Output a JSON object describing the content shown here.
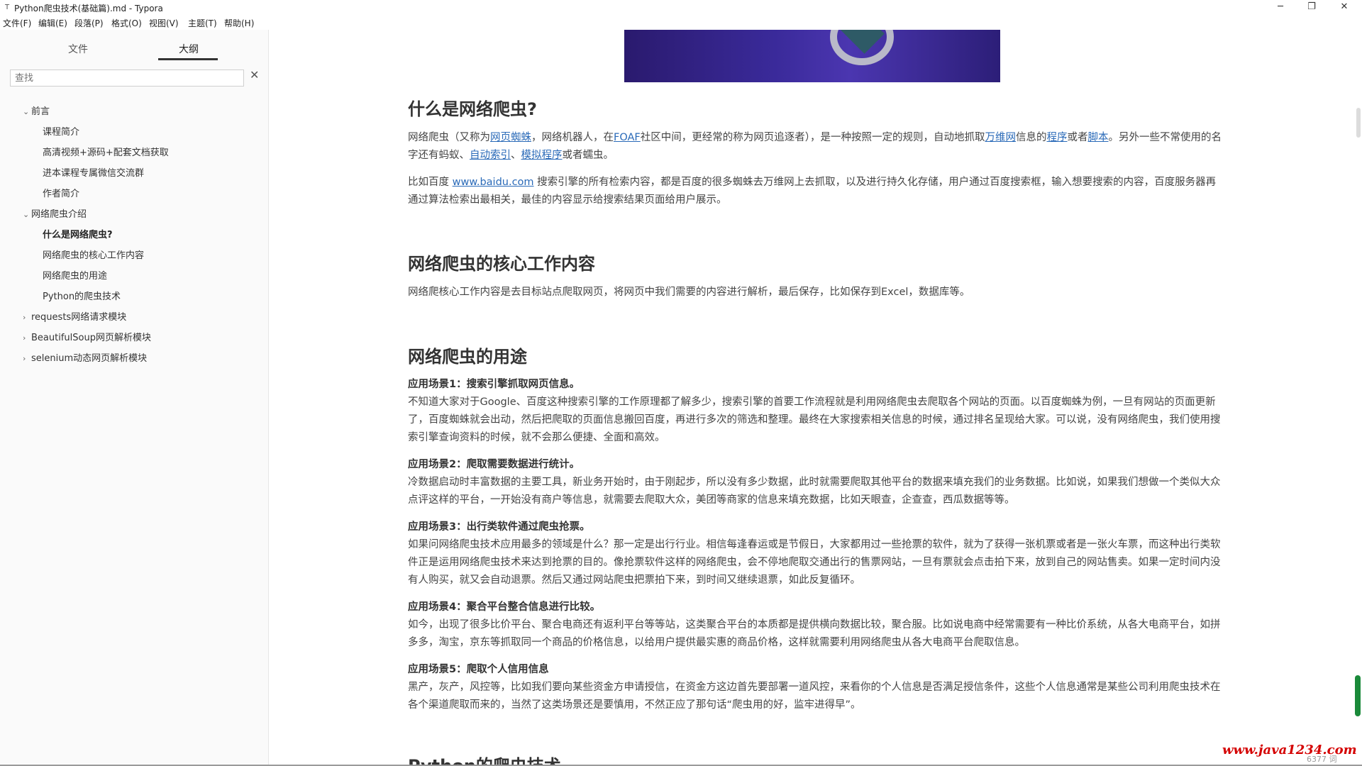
{
  "window": {
    "app_icon": "T",
    "title": "Python爬虫技术(基础篇).md - Typora",
    "min_glyph": "─",
    "max_glyph": "❐",
    "close_glyph": "✕"
  },
  "menu": [
    "文件(F)",
    "编辑(E)",
    "段落(P)",
    "格式(O)",
    "视图(V)",
    "主题(T)",
    "帮助(H)"
  ],
  "sidebar": {
    "tab_files": "文件",
    "tab_outline": "大纲",
    "search_placeholder": "查找",
    "search_clear": "✕",
    "items": [
      {
        "label": "前言",
        "chev": "⌄"
      },
      {
        "label": "课程简介"
      },
      {
        "label": "高清视频+源码+配套文档获取"
      },
      {
        "label": "进本课程专属微信交流群"
      },
      {
        "label": "作者简介"
      },
      {
        "label": "网络爬虫介绍",
        "chev": "⌄"
      },
      {
        "label": "什么是网络爬虫?"
      },
      {
        "label": "网络爬虫的核心工作内容"
      },
      {
        "label": "网络爬虫的用途"
      },
      {
        "label": "Python的爬虫技术"
      },
      {
        "label": "requests网络请求模块",
        "chev": "›"
      },
      {
        "label": "BeautifulSoup网页解析模块",
        "chev": "›"
      },
      {
        "label": "selenium动态网页解析模块",
        "chev": "›"
      }
    ],
    "footer_left": "‹",
    "footer_code": "</>"
  },
  "content": {
    "h_what": "什么是网络爬虫?",
    "p1": {
      "t1": "网络爬虫（又称为",
      "l1": "网页蜘蛛",
      "t2": "，网络机器人，在",
      "l2": "FOAF",
      "t3": "社区中间，更经常的称为网页追逐者），是一种按照一定的规则，自动地抓取",
      "l3": "万维网",
      "t4": "信息的",
      "l4": "程序",
      "t5": "或者",
      "l5": "脚本",
      "t6": "。另外一些不常使用的名字还有蚂蚁、",
      "l6": "自动索引",
      "t7": "、",
      "l7": "模拟程序",
      "t8": "或者蠕虫。"
    },
    "p2": {
      "t1": "比如百度 ",
      "l1": "www.baidu.com",
      "t2": " 搜索引擎的所有检索内容，都是百度的很多蜘蛛去万维网上去抓取，以及进行持久化存储，用户通过百度搜索框，输入想要搜索的内容，百度服务器再通过算法检索出最相关，最佳的内容显示给搜索结果页面给用户展示。"
    },
    "h_core": "网络爬虫的核心工作内容",
    "p_core": "网络爬核心工作内容是去目标站点爬取网页，将网页中我们需要的内容进行解析，最后保存，比如保存到Excel，数据库等。",
    "h_use": "网络爬虫的用途",
    "scenes": [
      {
        "label": "应用场景1：搜索引擎抓取网页信息。",
        "text": "不知道大家对于Google、百度这种搜索引擎的工作原理都了解多少，搜索引擎的首要工作流程就是利用网络爬虫去爬取各个网站的页面。以百度蜘蛛为例，一旦有网站的页面更新了，百度蜘蛛就会出动，然后把爬取的页面信息搬回百度，再进行多次的筛选和整理。最终在大家搜索相关信息的时候，通过排名呈现给大家。可以说，没有网络爬虫，我们使用搜索引擎查询资料的时候，就不会那么便捷、全面和高效。"
      },
      {
        "label": "应用场景2：爬取需要数据进行统计。",
        "text": "冷数据启动时丰富数据的主要工具，新业务开始时，由于刚起步，所以没有多少数据，此时就需要爬取其他平台的数据来填充我们的业务数据。比如说，如果我们想做一个类似大众点评这样的平台，一开始没有商户等信息，就需要去爬取大众，美团等商家的信息来填充数据，比如天眼查，企查查，西瓜数据等等。"
      },
      {
        "label": "应用场景3：出行类软件通过爬虫抢票。",
        "text": "如果问网络爬虫技术应用最多的领域是什么？那一定是出行行业。相信每逢春运或是节假日，大家都用过一些抢票的软件，就为了获得一张机票或者是一张火车票，而这种出行类软件正是运用网络爬虫技术来达到抢票的目的。像抢票软件这样的网络爬虫，会不停地爬取交通出行的售票网站，一旦有票就会点击拍下来，放到自己的网站售卖。如果一定时间内没有人购买，就又会自动退票。然后又通过网站爬虫把票拍下来，到时间又继续退票，如此反复循环。"
      },
      {
        "label": "应用场景4：聚合平台整合信息进行比较。",
        "text": "如今，出现了很多比价平台、聚合电商还有返利平台等等站，这类聚合平台的本质都是提供横向数据比较，聚合服。比如说电商中经常需要有一种比价系统，从各大电商平台，如拼多多，淘宝，京东等抓取同一个商品的价格信息，以给用户提供最实惠的商品价格，这样就需要利用网络爬虫从各大电商平台爬取信息。"
      },
      {
        "label": "应用场景5：爬取个人信用信息",
        "text": "黑产，灰产，风控等，比如我们要向某些资金方申请授信，在资金方这边首先要部署一道风控，来看你的个人信息是否满足授信条件，这些个人信息通常是某些公司利用爬虫技术在各个渠道爬取而来的，当然了这类场景还是要慎用，不然正应了那句话“爬虫用的好，监牢进得早”。"
      }
    ],
    "h_python": "Python的爬虫技术"
  },
  "overlay": {
    "watermark": "www.java1234.com",
    "wordcount": "6377 词"
  }
}
